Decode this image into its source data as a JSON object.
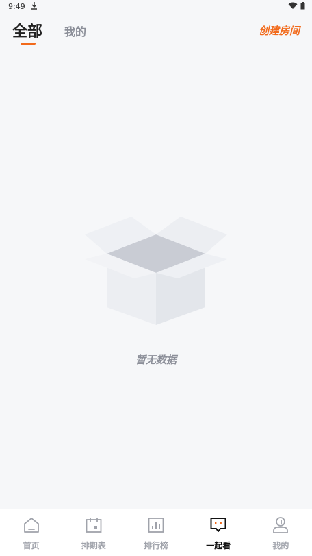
{
  "status_bar": {
    "time": "9:49"
  },
  "tabs": {
    "all_label": "全部",
    "mine_label": "我的"
  },
  "header": {
    "create_room_label": "创建房间"
  },
  "empty_state": {
    "message": "暂无数据"
  },
  "bottom_nav": {
    "items": [
      {
        "label": "首页",
        "icon": "home-icon"
      },
      {
        "label": "排期表",
        "icon": "calendar-icon"
      },
      {
        "label": "排行榜",
        "icon": "ranking-icon"
      },
      {
        "label": "一起看",
        "icon": "chat-icon",
        "active": true
      },
      {
        "label": "我的",
        "icon": "profile-icon"
      }
    ]
  },
  "colors": {
    "accent": "#f26a1b",
    "muted": "#8c8f99",
    "background": "#f6f7f9"
  }
}
